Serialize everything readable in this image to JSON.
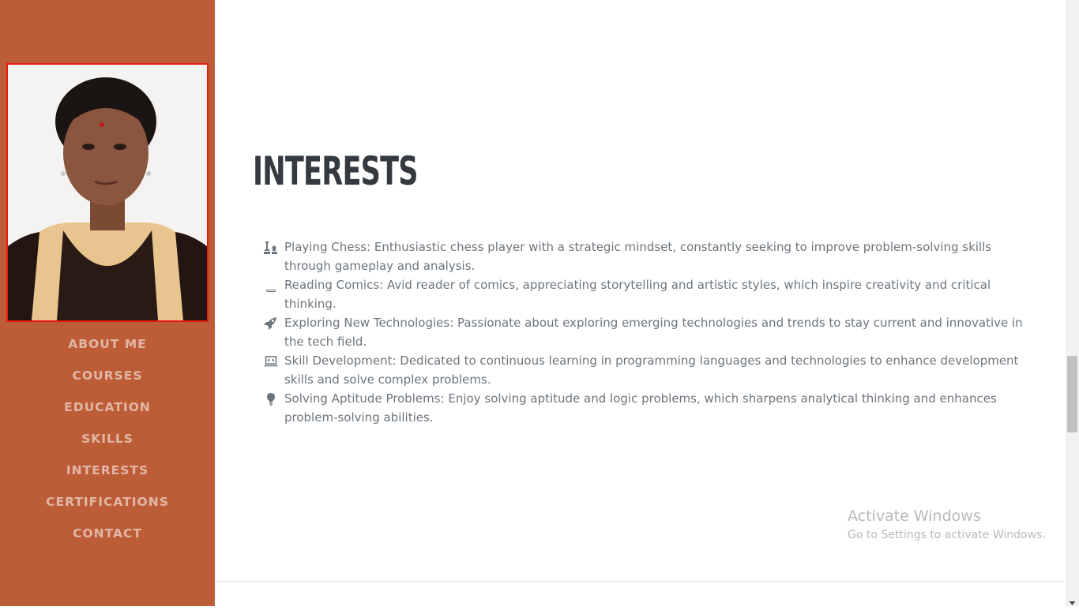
{
  "nav": {
    "items": [
      {
        "label": "ABOUT ME"
      },
      {
        "label": "COURSES"
      },
      {
        "label": "EDUCATION"
      },
      {
        "label": "SKILLS"
      },
      {
        "label": "INTERESTS"
      },
      {
        "label": "CERTIFICATIONS"
      },
      {
        "label": "CONTACT"
      }
    ]
  },
  "interests": {
    "title": "INTERESTS",
    "items": [
      {
        "icon": "chess-icon",
        "text": "Playing Chess: Enthusiastic chess player with a strategic mindset, constantly seeking to improve problem-solving skills through gameplay and analysis."
      },
      {
        "icon": "book-icon",
        "text": "Reading Comics: Avid reader of comics, appreciating storytelling and artistic styles, which inspire creativity and critical thinking."
      },
      {
        "icon": "rocket-icon",
        "text": "Exploring New Technologies: Passionate about exploring emerging technologies and trends to stay current and innovative in the tech field."
      },
      {
        "icon": "laptop-code-icon",
        "text": "Skill Development: Dedicated to continuous learning in programming languages and technologies to enhance development skills and solve complex problems."
      },
      {
        "icon": "lightbulb-icon",
        "text": "Solving Aptitude Problems: Enjoy solving aptitude and logic problems, which sharpens analytical thinking and enhances problem-solving abilities."
      }
    ]
  },
  "watermark": {
    "line1": "Activate Windows",
    "line2": "Go to Settings to activate Windows."
  },
  "colors": {
    "sidebar": "#bd5d38",
    "photo_border": "#e8190e",
    "heading": "#343a40",
    "body_text": "#6c757d"
  }
}
